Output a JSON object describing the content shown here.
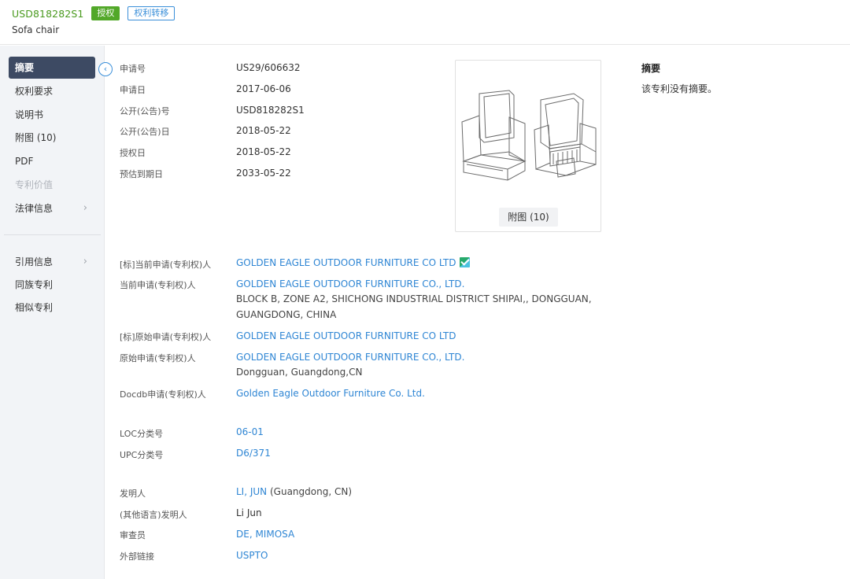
{
  "header": {
    "patent_number": "USD818282S1",
    "status_badge": "授权",
    "transfer_badge": "权利转移",
    "title": "Sofa chair"
  },
  "sidebar": {
    "collapse_icon": "chevron-left-icon",
    "items": [
      {
        "label": "摘要"
      },
      {
        "label": "权利要求"
      },
      {
        "label": "说明书"
      },
      {
        "label": "附图 (10)"
      },
      {
        "label": "PDF"
      },
      {
        "label": "专利价值"
      },
      {
        "label": "法律信息"
      },
      {
        "label": "引用信息"
      },
      {
        "label": "同族专利"
      },
      {
        "label": "相似专利"
      }
    ]
  },
  "details": {
    "application_no": {
      "label": "申请号",
      "value": "US29/606632"
    },
    "application_date": {
      "label": "申请日",
      "value": "2017-06-06"
    },
    "publication_no": {
      "label": "公开(公告)号",
      "value": "USD818282S1"
    },
    "publication_date": {
      "label": "公开(公告)日",
      "value": "2018-05-22"
    },
    "grant_date": {
      "label": "授权日",
      "value": "2018-05-22"
    },
    "expiry_date": {
      "label": "预估到期日",
      "value": "2033-05-22"
    },
    "std_current_assignee": {
      "label": "[标]当前申请(专利权)人",
      "value": "GOLDEN EAGLE OUTDOOR FURNITURE CO LTD"
    },
    "current_assignee": {
      "label": "当前申请(专利权)人",
      "value": "GOLDEN EAGLE OUTDOOR FURNITURE CO., LTD.",
      "address_line1": "BLOCK B, ZONE A2, SHICHONG INDUSTRIAL DISTRICT SHIPAI,, DONGGUAN,",
      "address_line2": "GUANGDONG, CHINA"
    },
    "std_original_assignee": {
      "label": "[标]原始申请(专利权)人",
      "value": "GOLDEN EAGLE OUTDOOR FURNITURE CO LTD"
    },
    "original_assignee": {
      "label": "原始申请(专利权)人",
      "value": "GOLDEN EAGLE OUTDOOR FURNITURE CO., LTD.",
      "address": "Dongguan, Guangdong,CN"
    },
    "docdb_assignee": {
      "label": "Docdb申请(专利权)人",
      "value": "Golden Eagle Outdoor Furniture Co. Ltd."
    },
    "loc_class": {
      "label": "LOC分类号",
      "value": "06-01"
    },
    "upc_class": {
      "label": "UPC分类号",
      "value": "D6/371"
    },
    "inventor": {
      "label": "发明人",
      "value": "LI, JUN",
      "location": "(Guangdong, CN)"
    },
    "inventor_other": {
      "label": "(其他语言)发明人",
      "value": "Li Jun"
    },
    "examiner": {
      "label": "审查员",
      "value": "DE, MIMOSA"
    },
    "external_link": {
      "label": "外部链接",
      "value": "USPTO"
    }
  },
  "image_panel": {
    "button_label": "附图 (10)"
  },
  "abstract": {
    "title": "摘要",
    "text": "该专利没有摘要。"
  },
  "colors": {
    "accent_link": "#2f86d4",
    "patent_green": "#4a9a1f",
    "badge_green": "#52a829",
    "nav_active": "#3d4a63"
  }
}
